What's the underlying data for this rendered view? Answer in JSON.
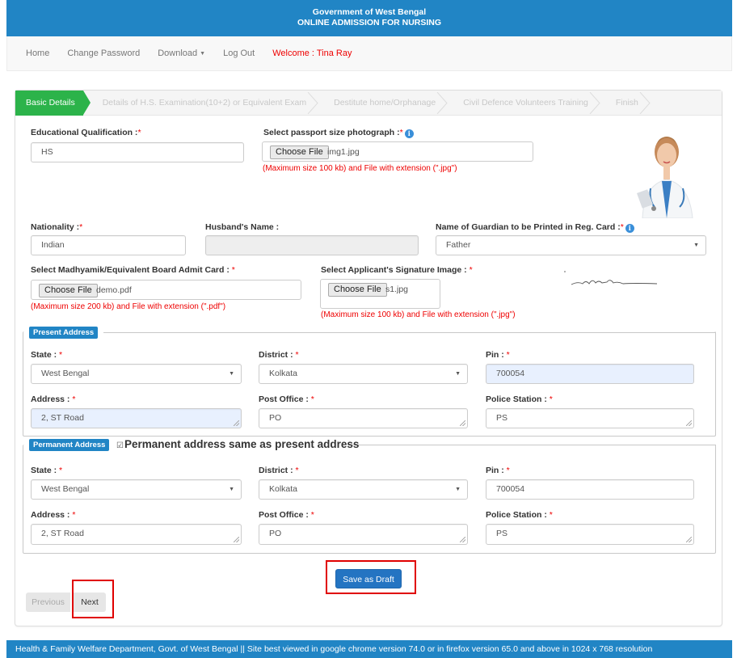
{
  "header": {
    "line1": "Government of West Bengal",
    "line2": "ONLINE ADMISSION FOR NURSING"
  },
  "nav": {
    "home": "Home",
    "change_password": "Change Password",
    "download": "Download",
    "logout": "Log Out",
    "welcome": "Welcome : Tina Ray"
  },
  "steps": [
    {
      "label": "Basic Details",
      "active": true
    },
    {
      "label": "Details of H.S. Examination(10+2) or Equivalent Exam",
      "active": false
    },
    {
      "label": "Destitute home/Orphanage",
      "active": false
    },
    {
      "label": "Civil Defence Volunteers Training",
      "active": false
    },
    {
      "label": "Finish",
      "active": false
    }
  ],
  "form": {
    "edu_qual": {
      "label": "Educational Qualification :",
      "req": "*",
      "value": "HS"
    },
    "photo": {
      "label": "Select passport size photograph :",
      "req": "*",
      "button": "Choose File",
      "file": "img1.jpg",
      "hint": "(Maximum size 100 kb) and File with extension (\".jpg\")"
    },
    "nationality": {
      "label": "Nationality :",
      "req": "*",
      "value": "Indian"
    },
    "husband": {
      "label": "Husband's Name :",
      "value": ""
    },
    "guardian": {
      "label": "Name of Guardian to be Printed in Reg. Card :",
      "req": "*",
      "value": "Father"
    },
    "admit_card": {
      "label": "Select Madhyamik/Equivalent Board Admit Card : ",
      "req": "*",
      "button": "Choose File",
      "file": "demo.pdf",
      "hint": "(Maximum size 200 kb) and File with extension (\".pdf\")"
    },
    "signature": {
      "label": "Select Applicant's Signature Image : ",
      "req": "*",
      "button": "Choose File",
      "file": "s1.jpg",
      "hint": "(Maximum size 100 kb) and File with extension (\".jpg\")"
    }
  },
  "present_address": {
    "legend": "Present Address",
    "state": {
      "label": "State : ",
      "req": "*",
      "value": "West Bengal"
    },
    "district": {
      "label": "District : ",
      "req": "*",
      "value": "Kolkata"
    },
    "pin": {
      "label": "Pin : ",
      "req": "*",
      "value": "700054"
    },
    "address": {
      "label": "Address : ",
      "req": "*",
      "value": "2, ST Road"
    },
    "post_office": {
      "label": "Post Office : ",
      "req": "*",
      "value": "PO"
    },
    "police_station": {
      "label": "Police Station : ",
      "req": "*",
      "value": "PS"
    }
  },
  "permanent_address": {
    "legend": "Permanent Address",
    "same_as_present": {
      "label": "Permanent address same as present address",
      "checked": true
    },
    "state": {
      "label": "State : ",
      "req": "*",
      "value": "West Bengal"
    },
    "district": {
      "label": "District : ",
      "req": "*",
      "value": "Kolkata"
    },
    "pin": {
      "label": "Pin : ",
      "req": "*",
      "value": "700054"
    },
    "address": {
      "label": "Address : ",
      "req": "*",
      "value": "2, ST Road"
    },
    "post_office": {
      "label": "Post Office : ",
      "req": "*",
      "value": "PO"
    },
    "police_station": {
      "label": "Police Station : ",
      "req": "*",
      "value": "PS"
    }
  },
  "buttons": {
    "save_draft": "Save as Draft",
    "previous": "Previous",
    "next": "Next"
  },
  "footer": {
    "text": "Health & Family Welfare Department, Govt. of West Bengal || Site best viewed in google chrome version 74.0 or in firefox version 65.0 and above in 1024 x 768 resolution"
  },
  "colors": {
    "brand_blue": "#2185c5",
    "active_step": "#2cb34a",
    "required": "#ee0000",
    "highlight": "#e00000"
  }
}
